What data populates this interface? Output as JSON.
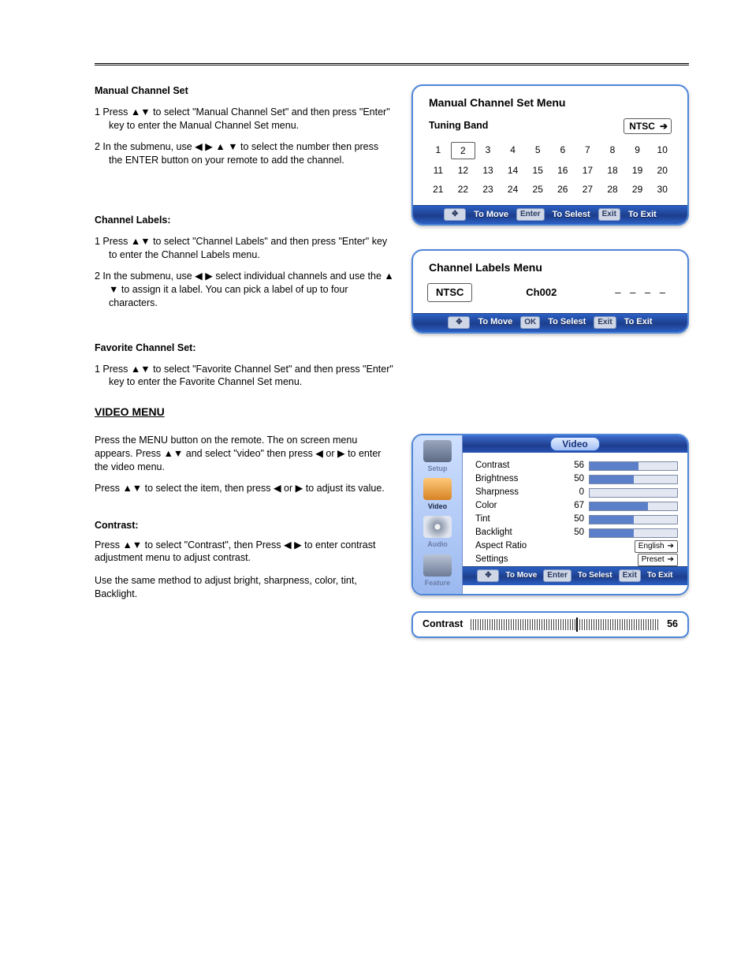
{
  "section_manual": {
    "heading": "Manual Channel Set",
    "step1_prefix": "1 Press ",
    "step1_arrows": "▲▼",
    "step1_mid": " to select \"Manual Channel Set\" and then press \"Enter\" key to enter the Manual Channel Set menu.",
    "step2_prefix": "2 In the submenu, use ",
    "step2_arrows": "◀ ▶ ▲ ▼",
    "step2_tail": " to select the number then press the ENTER button on your remote to add the channel."
  },
  "section_labels": {
    "heading": "Channel Labels:",
    "step1_prefix": "1 Press ",
    "step1_arrows": "▲▼",
    "step1_mid": " to select \"Channel Labels\" and then press \"Enter\" key to enter the Channel Labels menu.",
    "step2_prefix": "2 In the submenu, use ",
    "step2_arrows": "◀ ▶",
    "step2_tail": " select individual channels and use the ",
    "step2_arrows2": "▲ ▼",
    "step2_tail2": " to assign it a label. You can pick a label of up to four characters."
  },
  "section_favorite": {
    "heading": "Favorite Channel Set:",
    "step1_prefix": "1 Press ",
    "step1_arrows": "▲▼",
    "step1_tail": " to select \"Favorite Channel Set\" and then press \"Enter\" key to enter the Favorite Channel Set menu."
  },
  "section_video_title": "VIDEO MENU",
  "section_video": {
    "intro": "Press the MENU button on the remote. The on screen menu appears. Press ",
    "intro_arrows": "▲▼",
    "intro_mid": " and select \"video\" then press ",
    "intro_left": "◀",
    "intro_or": " or ",
    "intro_right": "▶",
    "intro_tail": " to enter the video menu.",
    "nav_prefix": "Press ",
    "nav_arrows": "▲▼",
    "nav_mid": " to select the item, then press ",
    "nav_left": "◀",
    "nav_or": " or ",
    "nav_right": "▶",
    "nav_tail": " to adjust its value."
  },
  "section_contrast": {
    "heading": "Contrast:",
    "step_prefix": "Press ",
    "step_arrows": "▲▼",
    "step_mid": " to select \"Contrast\", then Press ",
    "step_lr": "◀ ▶",
    "step_tail": " to enter contrast adjustment menu to adjust contrast.",
    "adjust": "Use the same method to adjust bright, sharpness, color, tint, Backlight."
  },
  "panels": {
    "manual": {
      "title": "Manual Channel Set Menu",
      "band_label": "Tuning Band",
      "band_value": "NTSC",
      "selected": 2,
      "cells": [
        "1",
        "2",
        "3",
        "4",
        "5",
        "6",
        "7",
        "8",
        "9",
        "10",
        "11",
        "12",
        "13",
        "14",
        "15",
        "16",
        "17",
        "18",
        "19",
        "20",
        "21",
        "22",
        "23",
        "24",
        "25",
        "26",
        "27",
        "28",
        "29",
        "30"
      ]
    },
    "labels": {
      "title": "Channel Labels Menu",
      "system": "NTSC",
      "channel": "Ch002",
      "placeholder": "– – – –"
    },
    "video": {
      "tab": "Video",
      "sidebar": [
        {
          "name": "Setup",
          "icon": "gear"
        },
        {
          "name": "Video",
          "icon": "monitor",
          "active": true
        },
        {
          "name": "Audio",
          "icon": "disc"
        },
        {
          "name": "Feature",
          "icon": "wrench"
        }
      ],
      "rows": [
        {
          "label": "Contrast",
          "value": 56,
          "kind": "bar"
        },
        {
          "label": "Brightness",
          "value": 50,
          "kind": "bar"
        },
        {
          "label": "Sharpness",
          "value": 0,
          "kind": "bar"
        },
        {
          "label": "Color",
          "value": 67,
          "kind": "bar"
        },
        {
          "label": "Tint",
          "value": 50,
          "kind": "bar"
        },
        {
          "label": "Backlight",
          "value": 50,
          "kind": "bar"
        },
        {
          "label": "Aspect Ratio",
          "text": "English",
          "kind": "box"
        },
        {
          "label": "Settings",
          "text": "Preset",
          "kind": "box"
        }
      ]
    },
    "contrast_widget": {
      "label": "Contrast",
      "value": 56
    },
    "hints": {
      "move": "To Move",
      "enter": "Enter",
      "enter_label": "To Selest",
      "ok": "OK",
      "exit": "Exit",
      "exit_label": "To Exit"
    }
  }
}
